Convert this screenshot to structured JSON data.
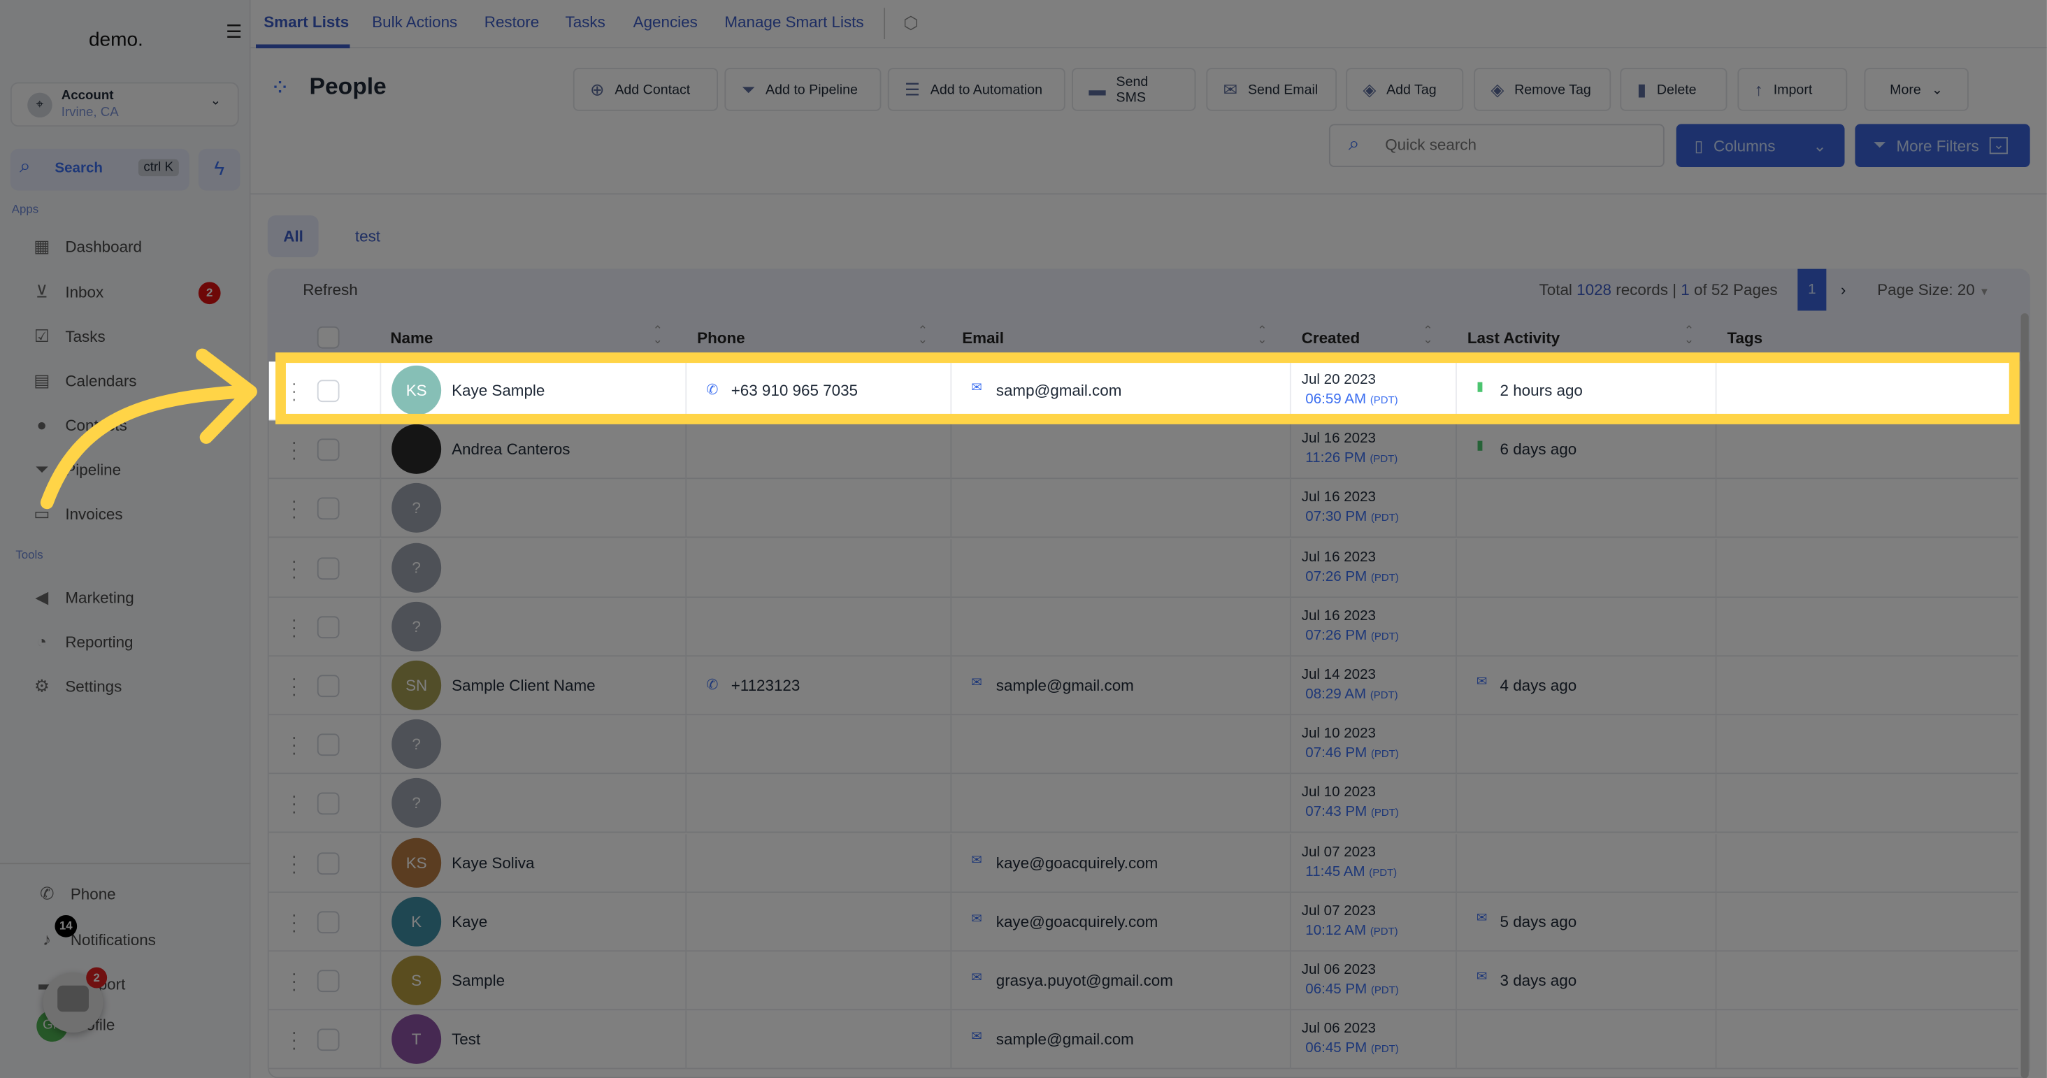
{
  "sidebar": {
    "logo": "demo.",
    "account": {
      "name": "Account",
      "location": "Irvine, CA"
    },
    "search": {
      "label": "Search",
      "shortcut": "ctrl K"
    },
    "apps_label": "Apps",
    "apps": [
      {
        "label": "Dashboard",
        "icon": "dashboard-icon"
      },
      {
        "label": "Inbox",
        "icon": "inbox-icon",
        "badge": "2"
      },
      {
        "label": "Tasks",
        "icon": "tasks-icon"
      },
      {
        "label": "Calendars",
        "icon": "calendar-icon"
      },
      {
        "label": "Contacts",
        "icon": "contacts-icon"
      },
      {
        "label": "Pipeline",
        "icon": "pipeline-icon"
      },
      {
        "label": "Invoices",
        "icon": "invoices-icon"
      }
    ],
    "tools_label": "Tools",
    "tools": [
      {
        "label": "Marketing",
        "icon": "megaphone-icon"
      },
      {
        "label": "Reporting",
        "icon": "pie-chart-icon"
      },
      {
        "label": "Settings",
        "icon": "gear-icon"
      }
    ],
    "bottom": [
      {
        "label": "Phone",
        "icon": "phone-icon"
      },
      {
        "label": "Notifications",
        "icon": "bell-icon",
        "badge": "14"
      },
      {
        "label": "Support",
        "icon": "support-icon"
      },
      {
        "label": "Profile",
        "icon": "avatar",
        "initials": "GP"
      }
    ],
    "chat_badge": "2"
  },
  "topnav": {
    "tabs": [
      "Smart Lists",
      "Bulk Actions",
      "Restore",
      "Tasks",
      "Agencies",
      "Manage Smart Lists"
    ],
    "active": "Smart Lists"
  },
  "page": {
    "title": "People"
  },
  "toolbar": [
    "Add Contact",
    "Add to Pipeline",
    "Add to Automation",
    "Send SMS",
    "Send Email",
    "Add Tag",
    "Remove Tag",
    "Delete",
    "Import",
    "More"
  ],
  "search": {
    "placeholder": "Quick search"
  },
  "columns_label": "Columns",
  "filters_label": "More Filters",
  "filter_tabs": [
    "All",
    "test"
  ],
  "table": {
    "refresh": "Refresh",
    "total_prefix": "Total",
    "total": "1028",
    "records": "records |",
    "page": "1",
    "of_pages": "of 52 Pages",
    "current_page": "1",
    "next": "›",
    "page_size": "Page Size: 20",
    "headers": [
      "Name",
      "Phone",
      "Email",
      "Created",
      "Last Activity",
      "Tags"
    ],
    "rows": [
      {
        "initials": "KS",
        "avatar_color": "#86bfb6",
        "name": "Kaye Sample",
        "phone": "+63 910 965 7035",
        "email": "samp@gmail.com",
        "date": "Jul 20 2023",
        "time": "06:59 AM",
        "tz": "(PDT)",
        "activity": "2 hours ago",
        "activity_icon": "sms-icon",
        "highlighted": true
      },
      {
        "initials": "",
        "avatar_color": "#2a2a2a",
        "name": "Andrea Canteros",
        "phone": "",
        "email": "",
        "date": "Jul 16 2023",
        "time": "11:26 PM",
        "tz": "(PDT)",
        "activity": "6 days ago",
        "activity_icon": "sms-icon"
      },
      {
        "initials": "?",
        "avatar_color": "#9ca3af",
        "name": "",
        "phone": "",
        "email": "",
        "date": "Jul 16 2023",
        "time": "07:30 PM",
        "tz": "(PDT)",
        "activity": ""
      },
      {
        "initials": "?",
        "avatar_color": "#9ca3af",
        "name": "",
        "phone": "",
        "email": "",
        "date": "Jul 16 2023",
        "time": "07:26 PM",
        "tz": "(PDT)",
        "activity": ""
      },
      {
        "initials": "?",
        "avatar_color": "#9ca3af",
        "name": "",
        "phone": "",
        "email": "",
        "date": "Jul 16 2023",
        "time": "07:26 PM",
        "tz": "(PDT)",
        "activity": ""
      },
      {
        "initials": "SN",
        "avatar_color": "#a59c52",
        "name": "Sample Client Name",
        "phone": "+1123123",
        "email": "sample@gmail.com",
        "date": "Jul 14 2023",
        "time": "08:29 AM",
        "tz": "(PDT)",
        "activity": "4 days ago",
        "activity_icon": "email-icon"
      },
      {
        "initials": "?",
        "avatar_color": "#9ca3af",
        "name": "",
        "phone": "",
        "email": "",
        "date": "Jul 10 2023",
        "time": "07:46 PM",
        "tz": "(PDT)",
        "activity": ""
      },
      {
        "initials": "?",
        "avatar_color": "#9ca3af",
        "name": "",
        "phone": "",
        "email": "",
        "date": "Jul 10 2023",
        "time": "07:43 PM",
        "tz": "(PDT)",
        "activity": ""
      },
      {
        "initials": "KS",
        "avatar_color": "#b77a42",
        "name": "Kaye Soliva",
        "phone": "",
        "email": "kaye@goacquirely.com",
        "date": "Jul 07 2023",
        "time": "11:45 AM",
        "tz": "(PDT)",
        "activity": ""
      },
      {
        "initials": "K",
        "avatar_color": "#3f8ea4",
        "name": "Kaye",
        "phone": "",
        "email": "kaye@goacquirely.com",
        "date": "Jul 07 2023",
        "time": "10:12 AM",
        "tz": "(PDT)",
        "activity": "5 days ago",
        "activity_icon": "email-icon"
      },
      {
        "initials": "S",
        "avatar_color": "#b59b3e",
        "name": "Sample",
        "phone": "",
        "email": "grasya.puyot@gmail.com",
        "date": "Jul 06 2023",
        "time": "06:45 PM",
        "tz": "(PDT)",
        "activity": "3 days ago",
        "activity_icon": "email-icon"
      },
      {
        "initials": "T",
        "avatar_color": "#8c52a4",
        "name": "Test",
        "phone": "",
        "email": "sample@gmail.com",
        "date": "Jul 06 2023",
        "time": "06:45 PM",
        "tz": "(PDT)",
        "activity": ""
      }
    ]
  },
  "colors": {
    "accent": "#3b62d8",
    "highlight": "#ffd447",
    "overlay": "rgba(0,0,0,0.5)"
  }
}
